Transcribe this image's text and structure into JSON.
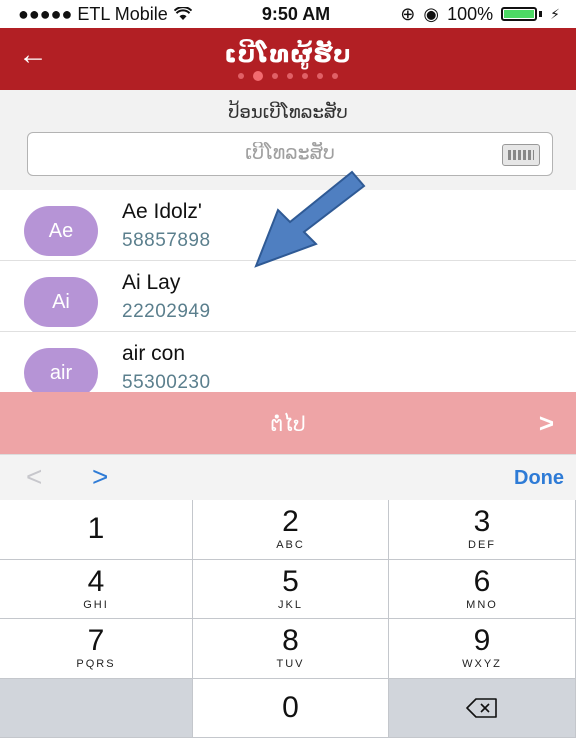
{
  "status_bar": {
    "carrier": "●●●●● ETL Mobile",
    "time": "9:50 AM",
    "battery": "100%"
  },
  "header": {
    "title": "ເບີໂທຜູ້ຮັບ",
    "back_icon": "arrow-left-icon",
    "page_indicator_count": 7,
    "page_indicator_active": 2
  },
  "search": {
    "caption": "ປ້ອນເບີໂທລະສັບ",
    "placeholder": "ເບີໂທລະສັບ",
    "value": ""
  },
  "contacts": [
    {
      "initials": "Ae",
      "name": "Ae Idolz'",
      "phone": "58857898"
    },
    {
      "initials": "Ai",
      "name": "Ai Lay",
      "phone": "22202949"
    },
    {
      "initials": "air",
      "name": "air con",
      "phone": "55300230"
    }
  ],
  "next_button": {
    "label": "ຕໍ່ໄປ",
    "icon": "chevron-right-icon"
  },
  "accessory": {
    "prev": "<",
    "next": ">",
    "done": "Done"
  },
  "keypad": [
    {
      "num": "1",
      "letters": ""
    },
    {
      "num": "2",
      "letters": "ABC"
    },
    {
      "num": "3",
      "letters": "DEF"
    },
    {
      "num": "4",
      "letters": "GHI"
    },
    {
      "num": "5",
      "letters": "JKL"
    },
    {
      "num": "6",
      "letters": "MNO"
    },
    {
      "num": "7",
      "letters": "PQRS"
    },
    {
      "num": "8",
      "letters": "TUV"
    },
    {
      "num": "9",
      "letters": "WXYZ"
    },
    {
      "num": "",
      "letters": ""
    },
    {
      "num": "0",
      "letters": ""
    },
    {
      "num": "",
      "letters": ""
    }
  ],
  "colors": {
    "header_red": "#b21f24",
    "next_pink": "#eea4a6",
    "avatar_purple": "#b694d6",
    "link_blue": "#2e7bd6",
    "arrow_blue": "#4f7fc1"
  }
}
